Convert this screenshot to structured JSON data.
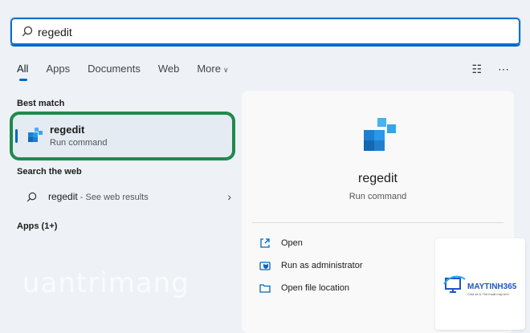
{
  "search": {
    "value": "regedit",
    "icon": "search-icon"
  },
  "tabs": [
    {
      "label": "All"
    },
    {
      "label": "Apps"
    },
    {
      "label": "Documents"
    },
    {
      "label": "Web"
    },
    {
      "label": "More"
    }
  ],
  "top_icons": [
    "connect-icon",
    "more-icon"
  ],
  "left": {
    "best_match_title": "Best match",
    "best_match": {
      "name": "regedit",
      "sub": "Run command"
    },
    "search_web_title": "Search the web",
    "web_result": {
      "name": "regedit",
      "suffix": " - See web results"
    },
    "apps_title": "Apps (1+)"
  },
  "right": {
    "title": "regedit",
    "subtitle": "Run command",
    "actions": [
      {
        "label": "Open",
        "icon": "open-icon"
      },
      {
        "label": "Run as administrator",
        "icon": "admin-shield-icon"
      },
      {
        "label": "Open file location",
        "icon": "folder-icon"
      }
    ]
  },
  "watermark": "uantrimang",
  "logo": {
    "brand": "MAYTINH365",
    "tagline": "Chia sẻ & Thủ thuật máy tính"
  },
  "colors": {
    "accent": "#0067c0",
    "highlight": "#1f8a4d"
  }
}
